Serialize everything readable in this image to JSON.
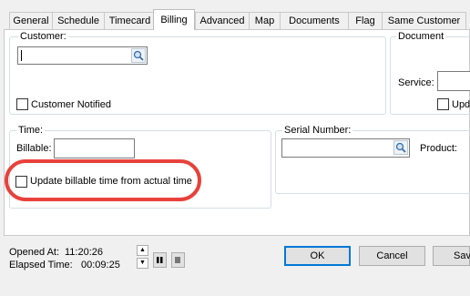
{
  "tabs": [
    {
      "label": "General"
    },
    {
      "label": "Schedule"
    },
    {
      "label": "Timecard"
    },
    {
      "label": "Billing"
    },
    {
      "label": "Advanced"
    },
    {
      "label": "Map"
    },
    {
      "label": "Documents"
    },
    {
      "label": "Flag"
    },
    {
      "label": "Same Customer"
    }
  ],
  "active_tab": "Billing",
  "customer": {
    "group_label": "Customer:",
    "value": "",
    "notified_label": "Customer Notified",
    "notified_checked": false
  },
  "document": {
    "group_label": "Document",
    "service_label": "Service:",
    "upd_label": "Upd"
  },
  "time": {
    "group_label": "Time:",
    "billable_label": "Billable:",
    "billable_value": "",
    "update_label": "Update billable time from actual time",
    "update_checked": false
  },
  "serial": {
    "label": "Serial Number:",
    "value": "",
    "product_label": "Product:"
  },
  "footer": {
    "opened_label": "Opened At:",
    "opened_value": "11:20:26",
    "elapsed_label": "Elapsed Time:",
    "elapsed_value": "00:09:25",
    "ok_label": "OK",
    "cancel_label": "Cancel",
    "save_label": "Sav"
  },
  "colors": {
    "highlight": "#e8413b",
    "focus_border": "#0078d7",
    "panel_border": "#c9c9c9"
  }
}
